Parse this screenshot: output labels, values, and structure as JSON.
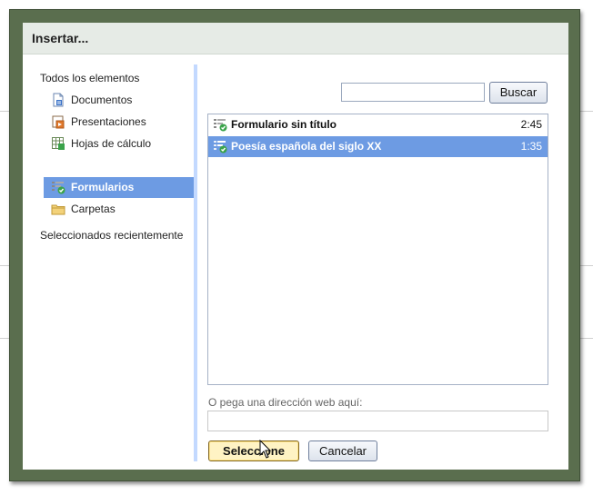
{
  "dialog": {
    "title": "Insertar..."
  },
  "sidebar": {
    "all_items": "Todos los elementos",
    "items": [
      {
        "label": "Documentos",
        "icon": "document-icon"
      },
      {
        "label": "Presentaciones",
        "icon": "presentation-icon"
      },
      {
        "label": "Hojas de cálculo",
        "icon": "spreadsheet-icon"
      },
      {
        "label": "Formularios",
        "icon": "form-icon",
        "selected": true
      },
      {
        "label": "Carpetas",
        "icon": "folder-icon"
      }
    ],
    "recent": "Seleccionados recientemente"
  },
  "search": {
    "value": "",
    "button_label": "Buscar"
  },
  "files": [
    {
      "name": "Formulario sin título",
      "time": "2:45",
      "icon": "form-icon",
      "selected": false
    },
    {
      "name": "Poesía española del siglo XX",
      "time": "1:35",
      "icon": "form-icon",
      "selected": true
    }
  ],
  "url": {
    "label": "O pega una dirección web aquí:",
    "value": ""
  },
  "buttons": {
    "select_label": "Seleccione",
    "cancel_label": "Cancelar"
  },
  "colors": {
    "frame": "#5a6e4e",
    "selection": "#6d9be3",
    "header": "#e6ebe6",
    "divider": "#c3d9ff"
  }
}
